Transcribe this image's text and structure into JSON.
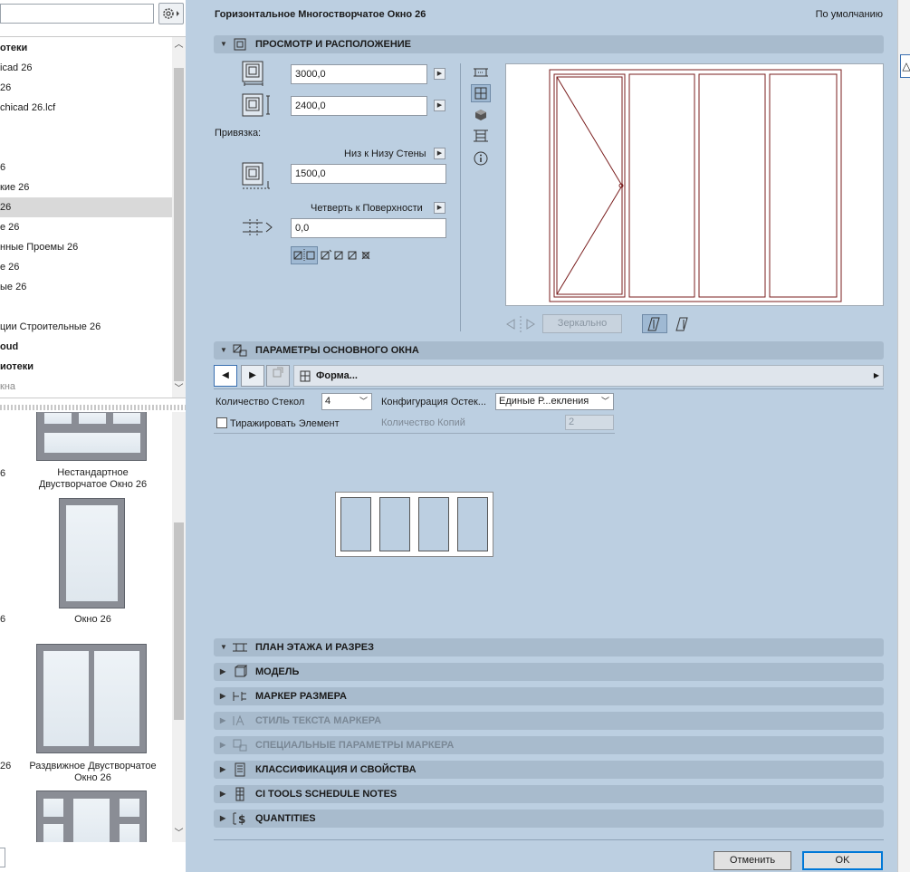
{
  "left_panel": {
    "tree_items": [
      {
        "label": "отеки",
        "bold": true
      },
      {
        "label": "icad 26"
      },
      {
        "label": "26"
      },
      {
        "label": "chicad 26.lcf"
      },
      {
        "label": ""
      },
      {
        "label": ""
      },
      {
        "label": "6"
      },
      {
        "label": "кие 26"
      },
      {
        "label": "26",
        "selected": true
      },
      {
        "label": "е 26"
      },
      {
        "label": "нные Проемы 26"
      },
      {
        "label": "е 26"
      },
      {
        "label": "ые 26"
      },
      {
        "label": ""
      },
      {
        "label": "ции Строительные 26"
      },
      {
        "label": "oud",
        "bold": true
      },
      {
        "label": "иотеки",
        "bold": true
      },
      {
        "label": "кна",
        "gray": true
      }
    ],
    "gallery": {
      "items": [
        {
          "label": "Нестандартное Двустворчатое Окно 26",
          "side": "6"
        },
        {
          "label": "Окно 26",
          "side": "6"
        },
        {
          "label": "Раздвижное Двустворчатое Окно 26",
          "side": "26"
        }
      ]
    }
  },
  "dialog": {
    "title": "Горизонтальное Многостворчатое Окно 26",
    "default_label": "По умолчанию",
    "sections": {
      "view": "ПРОСМОТР И РАСПОЛОЖЕНИЕ",
      "main_params": "ПАРАМЕТРЫ ОСНОВНОГО ОКНА",
      "plan": "ПЛАН ЭТАЖА И РАЗРЕЗ",
      "model": "МОДЕЛЬ",
      "dim_marker": "МАРКЕР РАЗМЕРА",
      "marker_text": "СТИЛЬ ТЕКСТА МАРКЕРА",
      "marker_special": "СПЕЦИАЛЬНЫЕ ПАРАМЕТРЫ МАРКЕРА",
      "classification": "КЛАССИФИКАЦИЯ И СВОЙСТВА",
      "ci_tools": "CI TOOLS SCHEDULE NOTES",
      "quantities": "QUANTITIES"
    },
    "view": {
      "width": "3000,0",
      "height": "2400,0",
      "anchor_label": "Привязка:",
      "anchor_mode": "Низ к Низу Стены",
      "sill": "1500,0",
      "reveal_mode": "Четверть к Поверхности",
      "reveal": "0,0",
      "mirror_label": "Зеркально"
    },
    "main_params": {
      "form_tab": "Форма...",
      "pane_count_label": "Количество Стекол",
      "pane_count": "4",
      "glazing_config_label": "Конфигурация Остек...",
      "glazing_config": "Единые Р...екления",
      "replicate_label": "Тиражировать Элемент",
      "copies_label": "Количество Копий",
      "copies": "2"
    },
    "buttons": {
      "cancel": "Отменить",
      "ok": "OK"
    }
  }
}
